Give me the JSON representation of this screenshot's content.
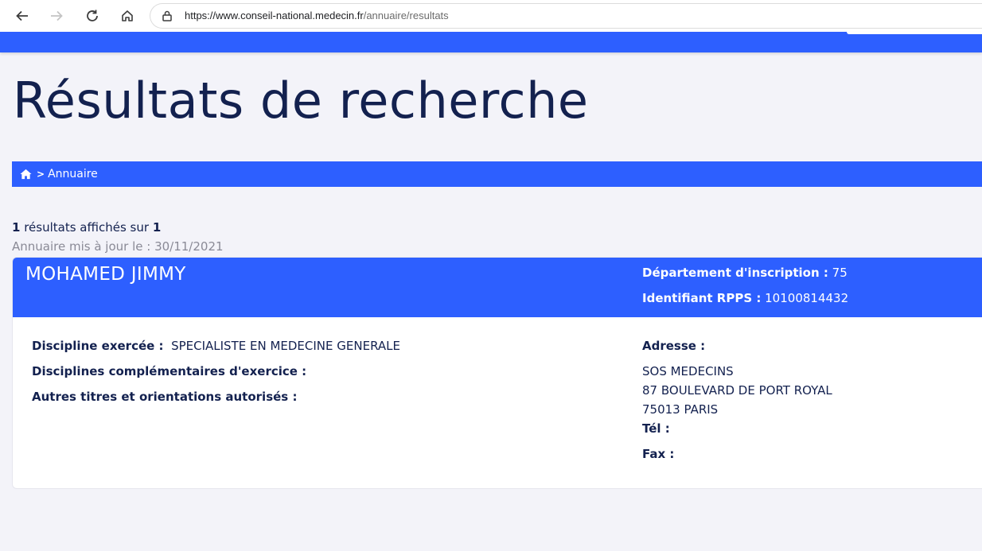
{
  "browser": {
    "url_host": "https://www.conseil-national.medecin.fr",
    "url_path": "/annuaire/resultats",
    "icons": [
      "back-icon",
      "forward-icon",
      "reload-icon",
      "home-icon",
      "lock-icon"
    ]
  },
  "page": {
    "title": "Résultats de recherche"
  },
  "breadcrumb": {
    "home_icon": "home-icon",
    "separator": ">",
    "item": "Annuaire"
  },
  "results": {
    "shown": "1",
    "shown_text": " résultats affichés sur ",
    "total": "1",
    "update_label": "Annuaire mis à jour le : ",
    "update_date": "30/11/2021"
  },
  "doctor": {
    "name": "MOHAMED JIMMY",
    "departement_label": "Département d'inscription :",
    "departement_value": "75",
    "rpps_label": "Identifiant RPPS :",
    "rpps_value": "10100814432",
    "discipline_label": "Discipline exercée :",
    "discipline_value": "SPECIALISTE EN MEDECINE GENERALE",
    "complementaires_label": "Disciplines complémentaires d'exercice :",
    "autres_label": "Autres titres et orientations autorisés :",
    "adresse_label": "Adresse :",
    "adresse_lines": [
      "SOS MEDECINS",
      "87 BOULEVARD DE PORT ROYAL",
      "75013 PARIS"
    ],
    "tel_label": "Tél :",
    "fax_label": "Fax :"
  },
  "colors": {
    "brand_blue": "#2d5fff",
    "title_navy": "#13214f",
    "page_bg": "#f3f3f9"
  }
}
